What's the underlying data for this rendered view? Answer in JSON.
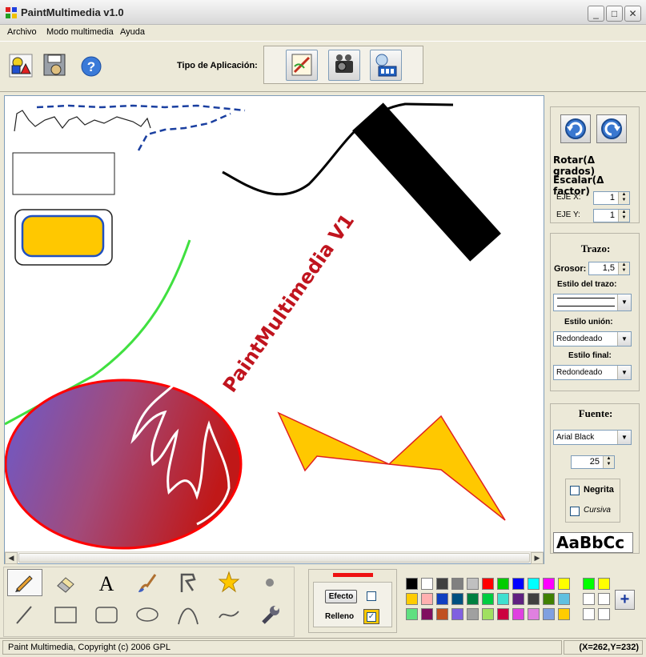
{
  "window": {
    "title": "PaintMultimedia v1.0",
    "min": "_",
    "max": "□",
    "close": "✕"
  },
  "menu": [
    "Archivo",
    "Modo multimedia",
    "Ayuda"
  ],
  "toolbar": {
    "icons": [
      "shapes-icon",
      "save-icon",
      "help-icon"
    ],
    "tipo_label": "Tipo de Aplicación:",
    "tipo_buttons": [
      "paint-app-icon",
      "camera-app-icon",
      "multimedia-app-icon"
    ]
  },
  "canvas": {
    "text": "PaintMultimedia V1"
  },
  "transform": {
    "rotar": "Rotar(Δ grados)",
    "escalar": "Escalar(Δ factor)",
    "eje_x_label": "EJE X:",
    "eje_x_value": "1",
    "eje_y_label": "EJE Y:",
    "eje_y_value": "1"
  },
  "trazo": {
    "title": "Trazo:",
    "grosor_label": "Grosor:",
    "grosor_value": "1,5",
    "estilo_label": "Estilo del trazo:",
    "union_label": "Estilo unión:",
    "union_value": "Redondeado",
    "final_label": "Estilo final:",
    "final_value": "Redondeado"
  },
  "fuente": {
    "title": "Fuente:",
    "font_value": "Arial Black",
    "size_value": "25",
    "negrita": "Negrita",
    "cursiva": "Cursiva",
    "preview": "AaBbCc"
  },
  "effects": {
    "efecto": "Efecto",
    "relleno": "Relleno",
    "efecto_checked": false,
    "relleno_checked": true,
    "stroke_color": "#ee1111"
  },
  "tools_row1": [
    "pencil-icon",
    "eraser-icon",
    "text-tool-icon",
    "brush-icon",
    "polyline-icon",
    "star-icon",
    "dot-icon"
  ],
  "tools_row2": [
    "line-icon",
    "rectangle-icon",
    "rounded-rect-icon",
    "ellipse-icon",
    "arc-icon",
    "curve-icon",
    "wrench-icon"
  ],
  "palette": {
    "row1": [
      "#000000",
      "#ffffff",
      "#404040",
      "#808080",
      "#c0c0c0",
      "#ff0000",
      "#00cc00",
      "#0000ff",
      "#00ffff",
      "#ff00ff",
      "#ffff00"
    ],
    "row2": [
      "#ffcc00",
      "#ffb0b0",
      "#1040c0",
      "#005080",
      "#008040",
      "#00cc40",
      "#40e0d0",
      "#602080",
      "#404040",
      "#408000",
      "#60c0e0"
    ],
    "row3": [
      "#60e080",
      "#801060",
      "#c05020",
      "#8060e0",
      "#a0a0a0",
      "#a0e060",
      "#cc0040",
      "#e040e0",
      "#e080e0",
      "#80a0e0",
      "#ffcc00"
    ],
    "extra": [
      "#00ff00",
      "#ffff00",
      "#ffffff",
      "#ffffff",
      "#ffffff",
      "#ffffff"
    ]
  },
  "status": {
    "left": "Paint Multimedia, Copyright (c) 2006 GPL",
    "right": "(X=262,Y=232)"
  }
}
